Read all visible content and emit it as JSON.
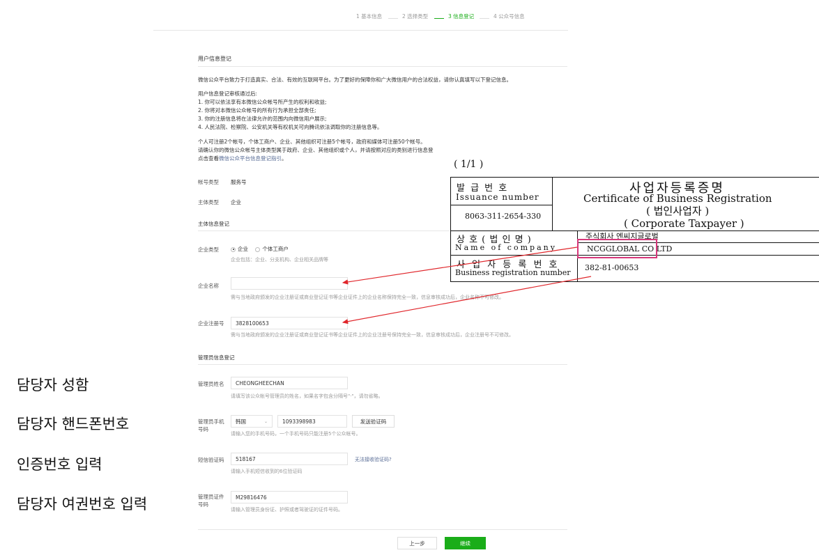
{
  "steps": [
    {
      "label": "1 基本信息",
      "active": false
    },
    {
      "label": "2 选择类型",
      "active": false
    },
    {
      "label": "3 信息登记",
      "active": true
    },
    {
      "label": "4 公众号信息",
      "active": false
    }
  ],
  "user_info": {
    "title": "用户信息登记",
    "intro": "微信公众平台致力于打造真实、合法、有效的互联网平台。为了更好的保障你和广大微信用户的合法权益，请你认真填写以下登记信息。",
    "review_heading": "用户信息登记审核通过后:",
    "review_items": [
      "1. 你可以依法享有本微信公众帐号所产生的权利和收益;",
      "2. 你将对本微信公众帐号的所有行为承担全部责任;",
      "3. 你的注册信息将在法律允许的范围内向微信用户展示;",
      "4. 人民法院、检察院、公安机关等有权机关可向腾讯依法调取你的注册信息等。"
    ],
    "limit_line1": "个人可注册2个帐号，个体工商户、企业、其他组织可注册5个帐号，政府和媒体可注册50个帐号。",
    "limit_line2": "请确认你的微信公众帐号主体类型属于政府、企业、其他组织或个人，并请按照对应的类别进行信息登",
    "guide_prefix": "点击查看",
    "guide_link": "微信公众平台信息登记指引",
    "guide_suffix": "。"
  },
  "account": {
    "type_label": "帐号类型",
    "type_value": "服务号",
    "subject_label": "主体类型",
    "subject_value": "企业"
  },
  "subject_section": {
    "title": "主体信息登记",
    "enterprise_type_label": "企业类型",
    "option_enterprise": "企业",
    "option_individual": "个体工商户",
    "enterprise_hint": "企业包括：企业、分支机构、企业相关品牌等",
    "company_name_label": "企业名称",
    "company_name_value": "",
    "company_name_hint": "需与当地政府颁发的企业注册证或商业登记证书等企业证件上的企业名称保持完全一致，信息审核成功后，企业名称不可修改。",
    "reg_no_label": "企业注册号",
    "reg_no_value": "3828100653",
    "reg_no_hint": "需与当地政府颁发的企业注册证或商业登记证书等企业证件上的企业注册号保持完全一致，信息审核成功后，企业注册号不可修改。"
  },
  "admin_section": {
    "title": "管理员信息登记",
    "name_label": "管理员姓名",
    "name_value": "CHEONGHEECHAN",
    "name_hint": "请填写该公众帐号管理员的姓名，如果名字包含分隔号\"·\"，请勿省略。",
    "phone_label_1": "管理员手机",
    "phone_label_2": "号码",
    "country_value": "韩国",
    "phone_value": "1093398983",
    "send_code_button": "发送验证码",
    "phone_hint": "请输入您的手机号码，一个手机号码只能注册5个公众帐号。",
    "sms_label": "短信验证码",
    "sms_value": "518167",
    "sms_help_link": "无法接收验证码?",
    "sms_hint": "请输入手机短信收到的6位验证码",
    "id_label_1": "管理员证件",
    "id_label_2": "号码",
    "id_value": "M29816476",
    "id_hint": "请输入管理员身份证、护照或者驾驶证的证件号码。"
  },
  "buttons": {
    "prev": "上一步",
    "next": "继续"
  },
  "certificate": {
    "page": "( 1/1 )",
    "issuance_ko": "발   급   번   호",
    "issuance_en": "Issuance number",
    "issuance_value": "8063-311-2654-330",
    "title_ko": "사업자등록증명",
    "title_en": "Certificate of Business Registration",
    "subtitle_ko": "( 법인사업자 )",
    "subtitle_en": "( Corporate Taxpayer )",
    "name_ko": "상   호  ( 법   인   명 )",
    "name_en": "Name  of  company",
    "name_value_ko": "주식회사 엔씨지글로벌",
    "name_value_en": "NCGGLOBAL CO LTD",
    "reg_ko": "사  업  자  등  록  번  호",
    "reg_en": "Business registration number",
    "reg_value": "382-81-00653"
  },
  "annotations": {
    "name": "담당자 성함",
    "phone": "담당자 핸드폰번호",
    "code": "인증번호 입력",
    "passport": "담당자 여권번호 입력"
  },
  "colors": {
    "accent": "#1aad19",
    "link": "#576b95",
    "arrow": "#e0262b",
    "highlight_box": "#d6377a"
  }
}
